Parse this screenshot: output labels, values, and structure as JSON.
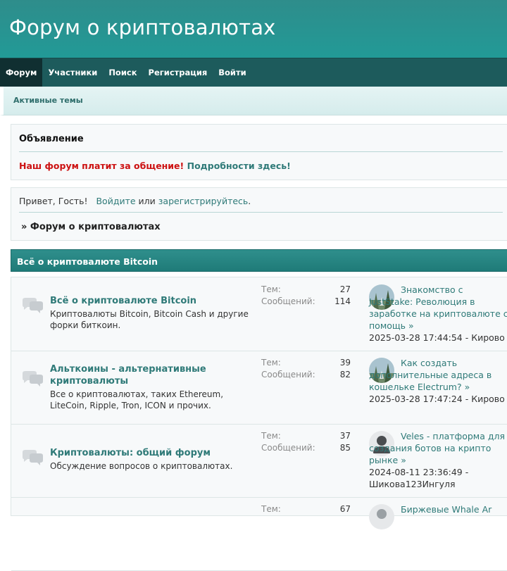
{
  "header": {
    "title": "Форум о криптовалютах"
  },
  "nav": [
    {
      "label": "Форум",
      "active": true
    },
    {
      "label": "Участники"
    },
    {
      "label": "Поиск"
    },
    {
      "label": "Регистрация"
    },
    {
      "label": "Войти"
    }
  ],
  "subnav": {
    "active_topics": "Активные темы"
  },
  "notice": {
    "title": "Объявление",
    "red_text": "Наш форум платит за общение!",
    "link_text": "Подробности здесь!"
  },
  "greeting": {
    "hello": "Привет, Гость!",
    "login": "Войдите",
    "or": "или",
    "register": "зарегистрируйтесь",
    "period": ".",
    "breadcrumb": "» Форум о криптовалютах"
  },
  "category": {
    "title": "Всё о криптовалюте Bitcoin"
  },
  "labels": {
    "topics": "Тем:",
    "messages": "Сообщений:"
  },
  "boards": [
    {
      "name": "Всё о криптовалюте Bitcoin",
      "description": "Криптовалюты Bitcoin, Bitcoin Cash и другие форки биткоин.",
      "topics": "27",
      "messages": "114",
      "last_post_title": "Знакомство с JustStake: Революция в заработке на криптовалюте с помощь",
      "last_post_arrow": "»",
      "last_post_meta": "2025-03-28 17:44:54 - Кирово"
    },
    {
      "name": "Альткоины - альтернативные криптовалюты",
      "description": "Все о криптовалютах, таких Ethereum, LiteCoin, Ripple, Tron, ICON и прочих.",
      "topics": "39",
      "messages": "82",
      "last_post_title": "Как создать дополнительные адреса в кошельке Electrum?",
      "last_post_arrow": "»",
      "last_post_meta": "2025-03-28 17:47:24 - Кирово"
    },
    {
      "name": "Криптовалюты: общий форум",
      "description": "Обсуждение вопросов о криптовалютах.",
      "topics": "37",
      "messages": "85",
      "last_post_title": "Veles - платформа для создания ботов на крипто рынке",
      "last_post_arrow": "»",
      "last_post_meta": "2024-08-11 23:36:49 - Шикова123Ингуля"
    },
    {
      "name": "",
      "description": "",
      "topics": "67",
      "messages": "",
      "last_post_title": "Биржевые Whale Ar",
      "last_post_arrow": "",
      "last_post_meta": ""
    }
  ],
  "colors": {
    "header": "#229a97",
    "nav": "#1d5b5c",
    "link": "#2f7a78",
    "notice_red": "#cc1111"
  }
}
